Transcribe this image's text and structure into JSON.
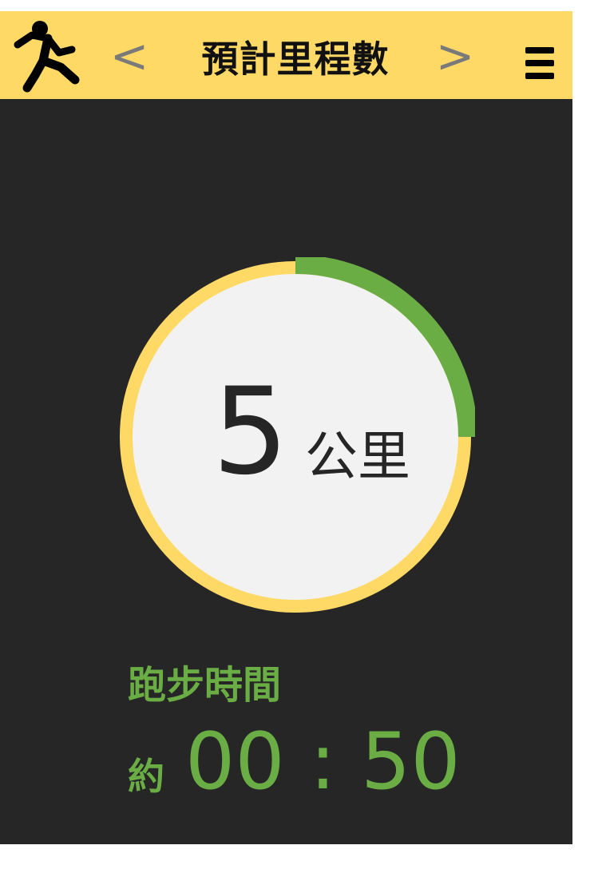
{
  "header": {
    "title": "預計里程數",
    "prev_label": "<",
    "next_label": ">",
    "app_icon": "running-person-icon",
    "menu_icon": "hamburger-menu-icon",
    "background_color": "#FFD966"
  },
  "distance": {
    "value": "5",
    "unit": "公里",
    "progress_fraction": 0.25,
    "track_color": "#FFD966",
    "progress_color": "#6AAD45"
  },
  "run_time": {
    "label": "跑步時間",
    "prefix": "約",
    "value": "00 : 50",
    "color": "#6AAD45"
  }
}
